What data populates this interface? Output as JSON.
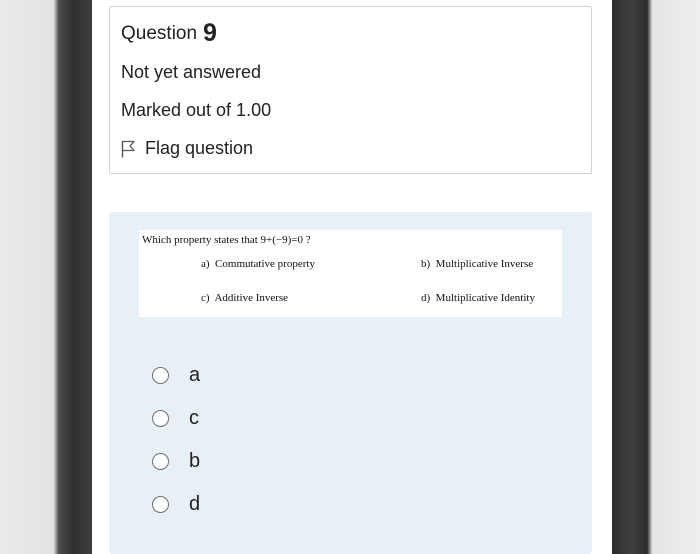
{
  "question": {
    "prefix": "Question",
    "number": "9",
    "state": "Not yet answered",
    "grade": "Marked out of 1.00",
    "flag_label": "Flag question"
  },
  "question_image": {
    "text": "Which property states that  9+(−9)=0 ?",
    "options": [
      {
        "letter": "a)",
        "text": "Commutative property"
      },
      {
        "letter": "b)",
        "text": "Multiplicative Inverse"
      },
      {
        "letter": "c)",
        "text": "Additive Inverse"
      },
      {
        "letter": "d)",
        "text": "Multiplicative Identity"
      }
    ]
  },
  "answers": [
    {
      "label": "a"
    },
    {
      "label": "c"
    },
    {
      "label": "b"
    },
    {
      "label": "d"
    }
  ],
  "icons": {
    "flag": "flag-icon"
  }
}
